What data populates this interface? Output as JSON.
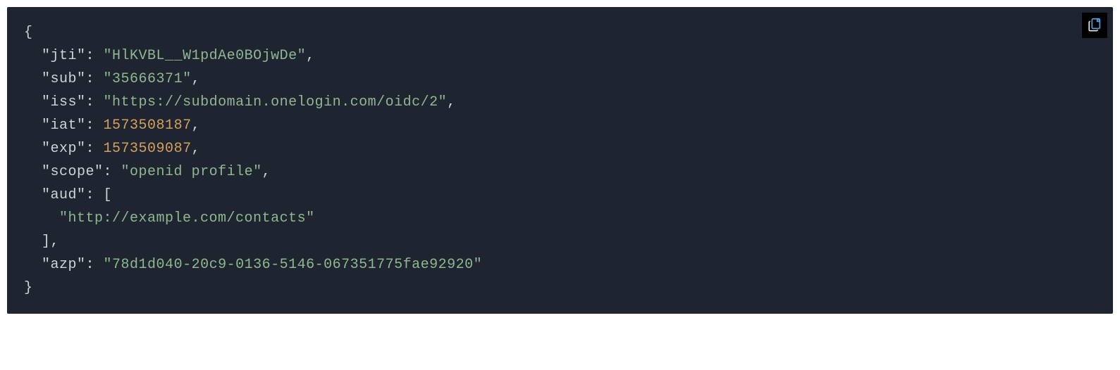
{
  "code": {
    "keys": {
      "jti": "\"jti\"",
      "sub": "\"sub\"",
      "iss": "\"iss\"",
      "iat": "\"iat\"",
      "exp": "\"exp\"",
      "scope": "\"scope\"",
      "aud": "\"aud\"",
      "azp": "\"azp\""
    },
    "values": {
      "jti": "\"HlKVBL__W1pdAe0BOjwDe\"",
      "sub": "\"35666371\"",
      "iss": "\"https://subdomain.onelogin.com/oidc/2\"",
      "iat": "1573508187",
      "exp": "1573509087",
      "scope": "\"openid profile\"",
      "aud_item": "\"http://example.com/contacts\"",
      "azp": "\"78d1d040-20c9-0136-5146-067351775fae92920\""
    },
    "punct": {
      "open_brace": "{",
      "close_brace": "}",
      "colon_space": ": ",
      "comma": ",",
      "open_bracket": "[",
      "close_bracket": "]"
    }
  }
}
